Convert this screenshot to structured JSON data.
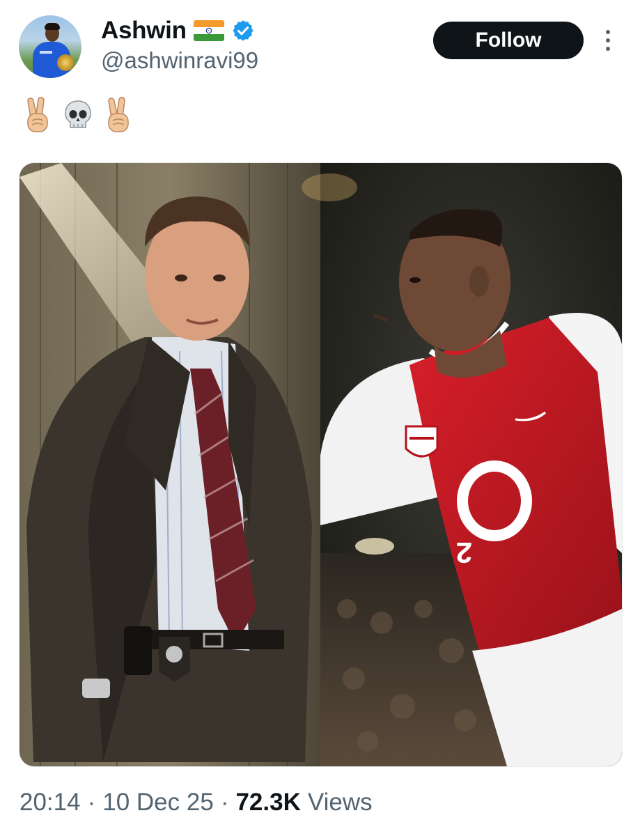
{
  "user": {
    "display_name": "Ashwin",
    "handle": "@ashwinravi99",
    "flag_icon": "india-flag-icon",
    "verified_icon": "verified-badge-icon",
    "verified_color": "#1d9bf0"
  },
  "actions": {
    "follow_label": "Follow",
    "more_icon": "more-options-icon"
  },
  "tweet": {
    "emojis": [
      "victory-hand-icon",
      "skull-icon",
      "victory-hand-icon"
    ]
  },
  "media": {
    "left_image": "man-in-suit-photo",
    "right_image": "footballer-red-jersey-photo",
    "jersey_number": "2"
  },
  "meta": {
    "time": "20:14",
    "date": "10 Dec 25",
    "views_count": "72.3K",
    "views_label": "Views",
    "separator": "·"
  },
  "colors": {
    "text_primary": "#0f1419",
    "text_secondary": "#536471",
    "button_bg": "#0f1419"
  }
}
